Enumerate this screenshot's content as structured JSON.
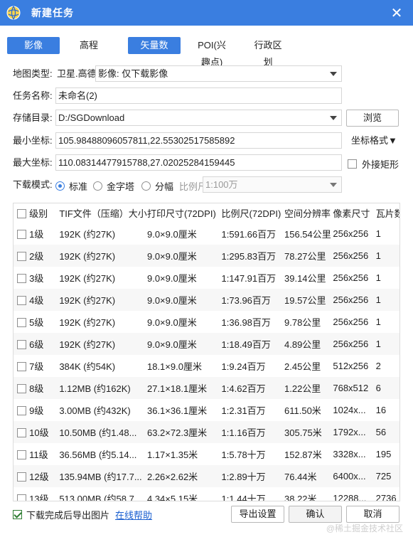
{
  "window": {
    "title": "新建任务",
    "close_symbol": "✕"
  },
  "tabs": [
    {
      "label": "影像",
      "active": true
    },
    {
      "label": "高程",
      "active": false
    },
    {
      "label": "矢量数据",
      "active": true
    },
    {
      "label": "POI(兴趣点)",
      "active": false
    },
    {
      "label": "行政区划",
      "active": false
    }
  ],
  "form": {
    "map_type_label": "地图类型:",
    "map_type_prefix": "卫星.高德",
    "map_type_value": "影像: 仅下载影像",
    "task_name_label": "任务名称:",
    "task_name_value": "未命名(2)",
    "storage_label": "存储目录:",
    "storage_value": "D:/SGDownload",
    "browse_label": "浏览",
    "min_coord_label": "最小坐标:",
    "min_coord_value": "105.98488096057811,22.55302517585892",
    "coord_format_label": "坐标格式▼",
    "max_coord_label": "最大坐标:",
    "max_coord_value": "110.08314477915788,27.02025284159445",
    "bounding_rect_label": "外接矩形",
    "mode_label": "下载模式:",
    "mode_standard": "标准",
    "mode_pyramid": "金字塔",
    "mode_split": "分幅",
    "scale_label": "比例尺:",
    "scale_value": "1:100万"
  },
  "table": {
    "headers": [
      "级别",
      "TIF文件（压缩）大小",
      "打印尺寸(72DPI)",
      "比例尺(72DPI)",
      "空间分辨率",
      "像素尺寸",
      "瓦片数"
    ],
    "rows": [
      [
        "1级",
        "192K (约27K)",
        "9.0×9.0厘米",
        "1:591.66百万",
        "156.54公里",
        "256x256",
        "1"
      ],
      [
        "2级",
        "192K (约27K)",
        "9.0×9.0厘米",
        "1:295.83百万",
        "78.27公里",
        "256x256",
        "1"
      ],
      [
        "3级",
        "192K (约27K)",
        "9.0×9.0厘米",
        "1:147.91百万",
        "39.14公里",
        "256x256",
        "1"
      ],
      [
        "4级",
        "192K (约27K)",
        "9.0×9.0厘米",
        "1:73.96百万",
        "19.57公里",
        "256x256",
        "1"
      ],
      [
        "5级",
        "192K (约27K)",
        "9.0×9.0厘米",
        "1:36.98百万",
        "9.78公里",
        "256x256",
        "1"
      ],
      [
        "6级",
        "192K (约27K)",
        "9.0×9.0厘米",
        "1:18.49百万",
        "4.89公里",
        "256x256",
        "1"
      ],
      [
        "7级",
        "384K (约54K)",
        "18.1×9.0厘米",
        "1:9.24百万",
        "2.45公里",
        "512x256",
        "2"
      ],
      [
        "8级",
        "1.12MB (约162K)",
        "27.1×18.1厘米",
        "1:4.62百万",
        "1.22公里",
        "768x512",
        "6"
      ],
      [
        "9级",
        "3.00MB (约432K)",
        "36.1×36.1厘米",
        "1:2.31百万",
        "611.50米",
        "1024x...",
        "16"
      ],
      [
        "10级",
        "10.50MB (约1.48...",
        "63.2×72.3厘米",
        "1:1.16百万",
        "305.75米",
        "1792x...",
        "56"
      ],
      [
        "11级",
        "36.56MB (约5.14...",
        "1.17×1.35米",
        "1:5.78十万",
        "152.87米",
        "3328x...",
        "195"
      ],
      [
        "12级",
        "135.94MB (约17.7...",
        "2.26×2.62米",
        "1:2.89十万",
        "76.44米",
        "6400x...",
        "725"
      ],
      [
        "13级",
        "513.00MB (约58.7...",
        "4.34×5.15米",
        "1:1.44十万",
        "38.22米",
        "12288...",
        "2736"
      ]
    ]
  },
  "footer": {
    "export_check_label": "下载完成后导出图片",
    "help_link": "在线帮助",
    "export_settings": "导出设置",
    "confirm": "确认",
    "cancel": "取消",
    "watermark": "@稀土掘金技术社区"
  },
  "colors": {
    "accent": "#3a7ee0",
    "check": "#2e7d32",
    "link": "#1a5fd0"
  }
}
